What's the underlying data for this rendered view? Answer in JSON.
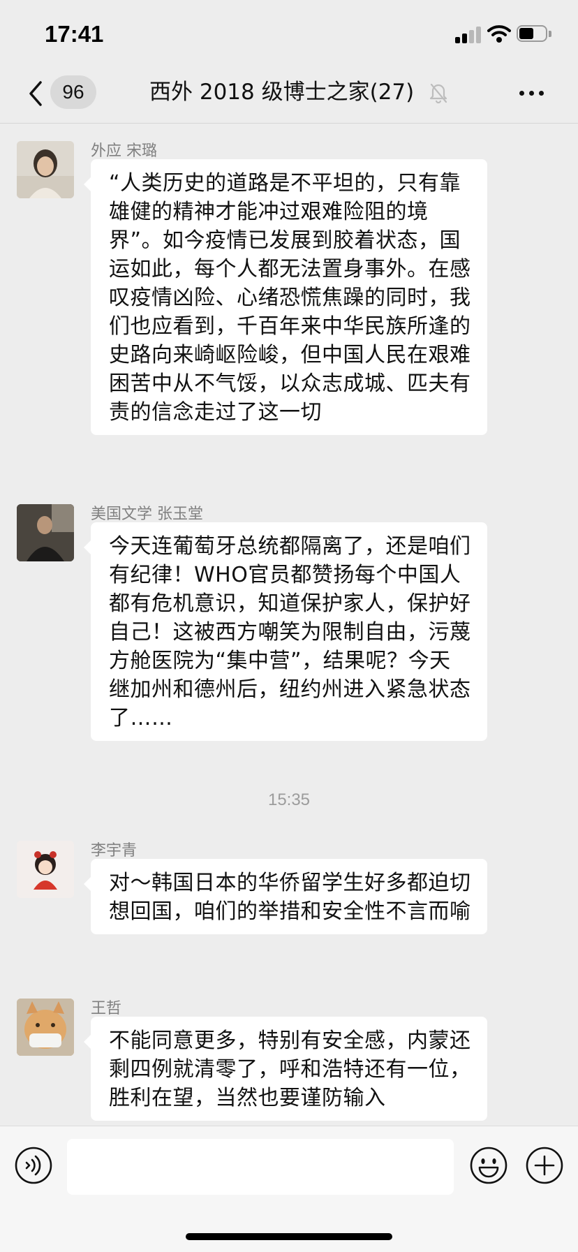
{
  "status_bar": {
    "time": "17:41",
    "icons": [
      "signal-icon",
      "wifi-icon",
      "battery-icon"
    ]
  },
  "nav": {
    "back_icon": "chevron-left-icon",
    "unread_count": "96",
    "title": "西外 2018 级博士之家(27)",
    "mute_icon": "bell-slash-icon",
    "more_icon": "ellipsis-icon"
  },
  "messages": [
    {
      "sender": "外应 宋璐",
      "text": "“人类历史的道路是不平坦的，只有靠雄健的精神才能冲过艰难险阻的境界”。如今疫情已发展到胶着状态，国运如此，每个人都无法置身事外。在感叹疫情凶险、心绪恐慌焦躁的同时，我们也应看到，千百年来中华民族所逢的史路向来崎岖险峻，但中国人民在艰难困苦中从不气馁，以众志成城、匹夫有责的信念走过了这一切"
    },
    {
      "sender": "美国文学 张玉堂",
      "text": "今天连葡萄牙总统都隔离了，还是咱们有纪律！WHO官员都赞扬每个中国人都有危机意识，知道保护家人，保护好自己！这被西方嘲笑为限制自由，污蔑方舱医院为“集中营”，结果呢？今天继加州和德州后，纽约州进入紧急状态了……"
    },
    {
      "sender": "李宇青",
      "text": "对～韩国日本的华侨留学生好多都迫切想回国，咱们的举措和安全性不言而喻"
    },
    {
      "sender": "王哲",
      "text": "不能同意更多，特别有安全感，内蒙还剩四例就清零了，呼和浩特还有一位，胜利在望，当然也要谨防输入"
    }
  ],
  "timestamp": "15:35",
  "input_bar": {
    "voice_icon": "voice-icon",
    "input_value": "",
    "emoji_icon": "emoji-icon",
    "plus_icon": "plus-circle-icon"
  }
}
